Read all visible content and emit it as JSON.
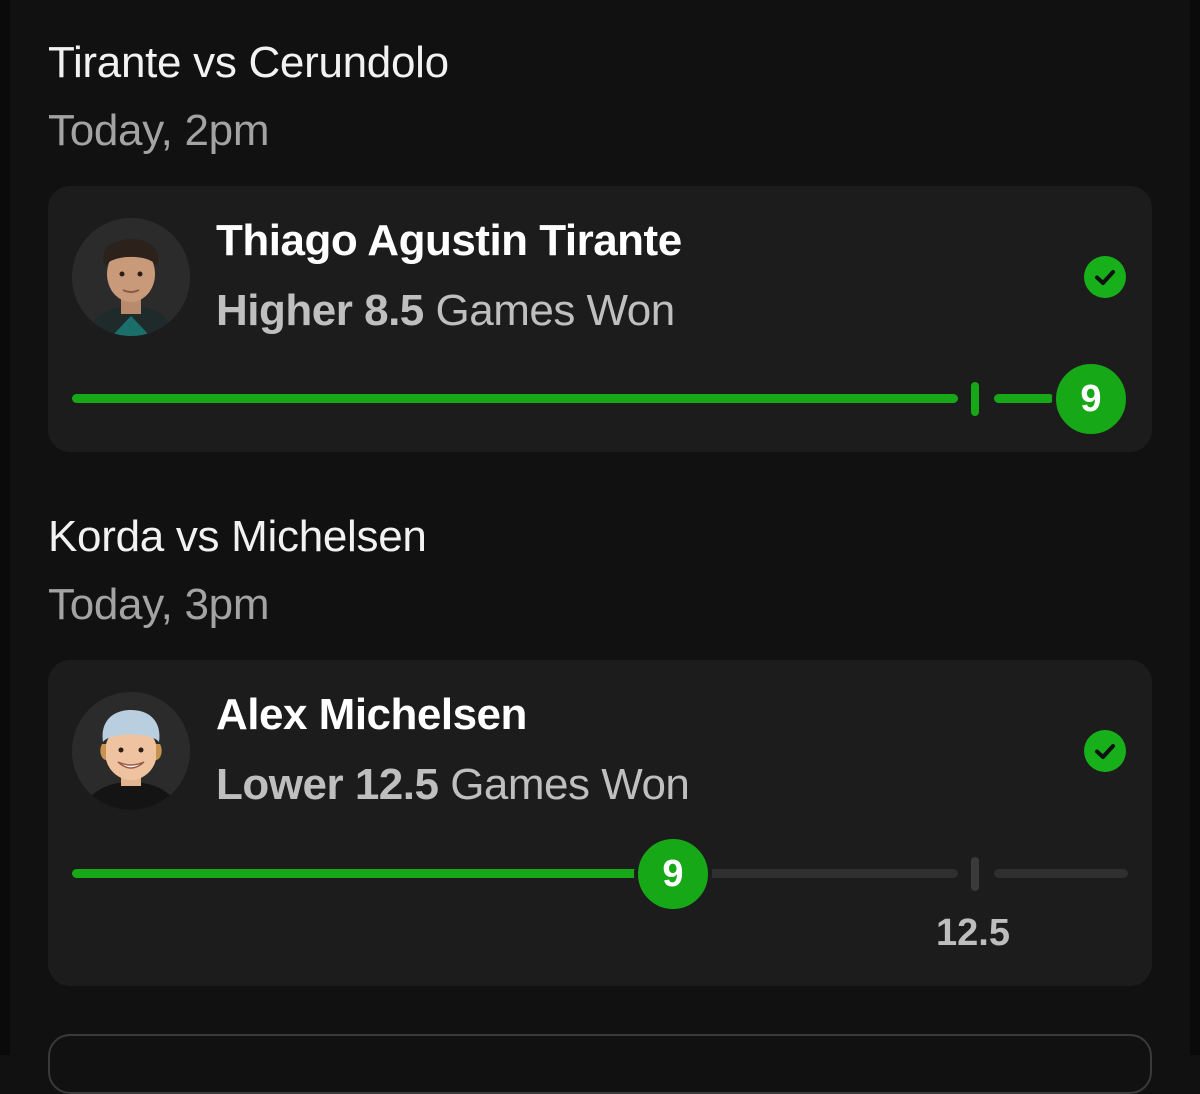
{
  "matches": [
    {
      "title": "Tirante vs Cerundolo",
      "time": "Today, 2pm",
      "pick": {
        "player": "Thiago Agustin Tirante",
        "direction": "Higher",
        "line": "8.5",
        "stat": "Games Won",
        "result": "9",
        "status": "won",
        "status_icon": "check-circle-icon"
      }
    },
    {
      "title": "Korda vs Michelsen",
      "time": "Today, 3pm",
      "pick": {
        "player": "Alex Michelsen",
        "direction": "Lower",
        "line": "12.5",
        "stat": "Games Won",
        "result": "9",
        "line_label": "12.5",
        "status": "won",
        "status_icon": "check-circle-icon"
      }
    }
  ],
  "colors": {
    "success": "#16a817",
    "track_inactive": "#2f2f2f",
    "card_bg": "#1c1c1c"
  }
}
